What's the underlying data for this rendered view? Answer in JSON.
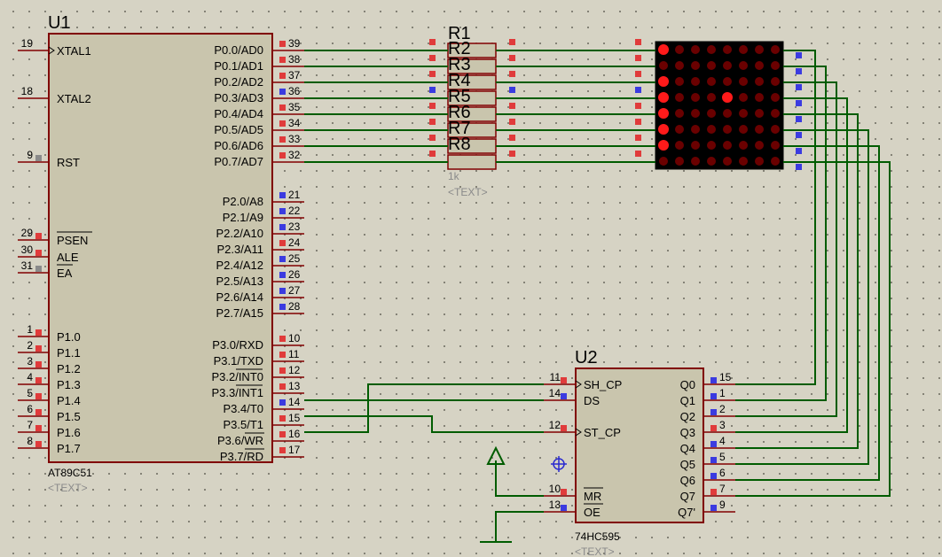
{
  "u1": {
    "ref": "U1",
    "part": "AT89C51",
    "text": "<TEXT>",
    "left_pins": [
      {
        "num": "19",
        "name": "XTAL1"
      },
      {
        "num": "18",
        "name": "XTAL2"
      },
      {
        "num": "9",
        "name": "RST"
      },
      {
        "num": "29",
        "name": "PSEN"
      },
      {
        "num": "30",
        "name": "ALE"
      },
      {
        "num": "31",
        "name": "EA"
      },
      {
        "num": "1",
        "name": "P1.0"
      },
      {
        "num": "2",
        "name": "P1.1"
      },
      {
        "num": "3",
        "name": "P1.2"
      },
      {
        "num": "4",
        "name": "P1.3"
      },
      {
        "num": "5",
        "name": "P1.4"
      },
      {
        "num": "6",
        "name": "P1.5"
      },
      {
        "num": "7",
        "name": "P1.6"
      },
      {
        "num": "8",
        "name": "P1.7"
      }
    ],
    "right_pins": [
      {
        "num": "39",
        "name": "P0.0/AD0"
      },
      {
        "num": "38",
        "name": "P0.1/AD1"
      },
      {
        "num": "37",
        "name": "P0.2/AD2"
      },
      {
        "num": "36",
        "name": "P0.3/AD3"
      },
      {
        "num": "35",
        "name": "P0.4/AD4"
      },
      {
        "num": "34",
        "name": "P0.5/AD5"
      },
      {
        "num": "33",
        "name": "P0.6/AD6"
      },
      {
        "num": "32",
        "name": "P0.7/AD7"
      },
      {
        "num": "21",
        "name": "P2.0/A8"
      },
      {
        "num": "22",
        "name": "P2.1/A9"
      },
      {
        "num": "23",
        "name": "P2.2/A10"
      },
      {
        "num": "24",
        "name": "P2.3/A11"
      },
      {
        "num": "25",
        "name": "P2.4/A12"
      },
      {
        "num": "26",
        "name": "P2.5/A13"
      },
      {
        "num": "27",
        "name": "P2.6/A14"
      },
      {
        "num": "28",
        "name": "P2.7/A15"
      },
      {
        "num": "10",
        "name": "P3.0/RXD"
      },
      {
        "num": "11",
        "name": "P3.1/TXD"
      },
      {
        "num": "12",
        "name": "P3.2/INT0"
      },
      {
        "num": "13",
        "name": "P3.3/INT1"
      },
      {
        "num": "14",
        "name": "P3.4/T0"
      },
      {
        "num": "15",
        "name": "P3.5/T1"
      },
      {
        "num": "16",
        "name": "P3.6/WR"
      },
      {
        "num": "17",
        "name": "P3.7/RD"
      }
    ]
  },
  "rpack": {
    "refs": [
      "R1",
      "R2",
      "R3",
      "R4",
      "R5",
      "R6",
      "R7",
      "R8"
    ],
    "value": "1k",
    "text": "<TEXT>"
  },
  "u2": {
    "ref": "U2",
    "part": "74HC595",
    "text": "<TEXT>",
    "left_pins": [
      {
        "num": "11",
        "name": "SH_CP"
      },
      {
        "num": "14",
        "name": "DS"
      },
      {
        "num": "12",
        "name": "ST_CP"
      },
      {
        "num": "10",
        "name": "MR"
      },
      {
        "num": "13",
        "name": "OE"
      }
    ],
    "right_pins": [
      {
        "num": "15",
        "name": "Q0"
      },
      {
        "num": "1",
        "name": "Q1"
      },
      {
        "num": "2",
        "name": "Q2"
      },
      {
        "num": "3",
        "name": "Q3"
      },
      {
        "num": "4",
        "name": "Q4"
      },
      {
        "num": "5",
        "name": "Q5"
      },
      {
        "num": "6",
        "name": "Q6"
      },
      {
        "num": "7",
        "name": "Q7"
      },
      {
        "num": "9",
        "name": "Q7'"
      }
    ]
  },
  "matrix": {
    "rows": 8,
    "cols": 8,
    "lit": [
      [
        0,
        0
      ],
      [
        2,
        0
      ],
      [
        3,
        0
      ],
      [
        3,
        4
      ],
      [
        4,
        0
      ],
      [
        5,
        0
      ],
      [
        6,
        0
      ]
    ]
  },
  "colors": {
    "background": "#d6d3c4",
    "body_fill": "#c9c5ad",
    "body_stroke": "#800000",
    "wire": "#005c00",
    "pin_red": "#e03b3b",
    "pin_blue": "#3b3be0",
    "pin_grey": "#8a8a8a",
    "led_off": "#6a0000",
    "led_on": "#ff1a1a"
  }
}
